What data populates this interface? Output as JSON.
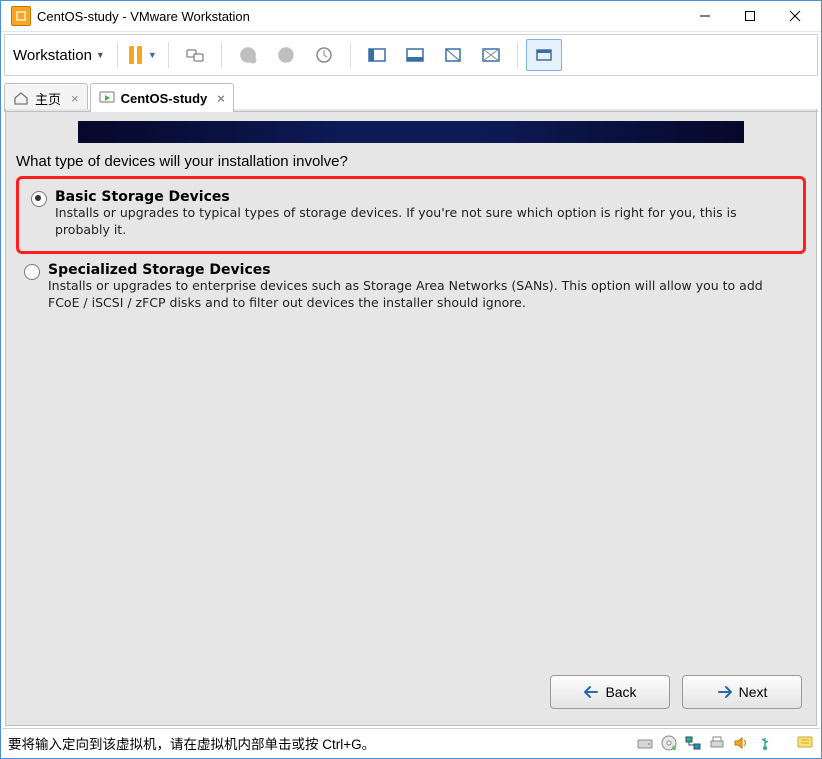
{
  "window": {
    "title": "CentOS-study - VMware Workstation"
  },
  "menu": {
    "workstation": "Workstation"
  },
  "tabs": {
    "home": "主页",
    "vm": "CentOS-study"
  },
  "installer": {
    "prompt": "What type of devices will your installation involve?",
    "options": [
      {
        "title": "Basic Storage Devices",
        "desc": "Installs or upgrades to typical types of storage devices.  If you're not sure which option is right for you, this is probably it."
      },
      {
        "title": "Specialized Storage Devices",
        "desc": "Installs or upgrades to enterprise devices such as Storage Area Networks (SANs). This option will allow you to add FCoE / iSCSI / zFCP disks and to filter out devices the installer should ignore."
      }
    ],
    "back": "Back",
    "next": "Next"
  },
  "status": {
    "message": "要将输入定向到该虚拟机，请在虚拟机内部单击或按 Ctrl+G。"
  }
}
